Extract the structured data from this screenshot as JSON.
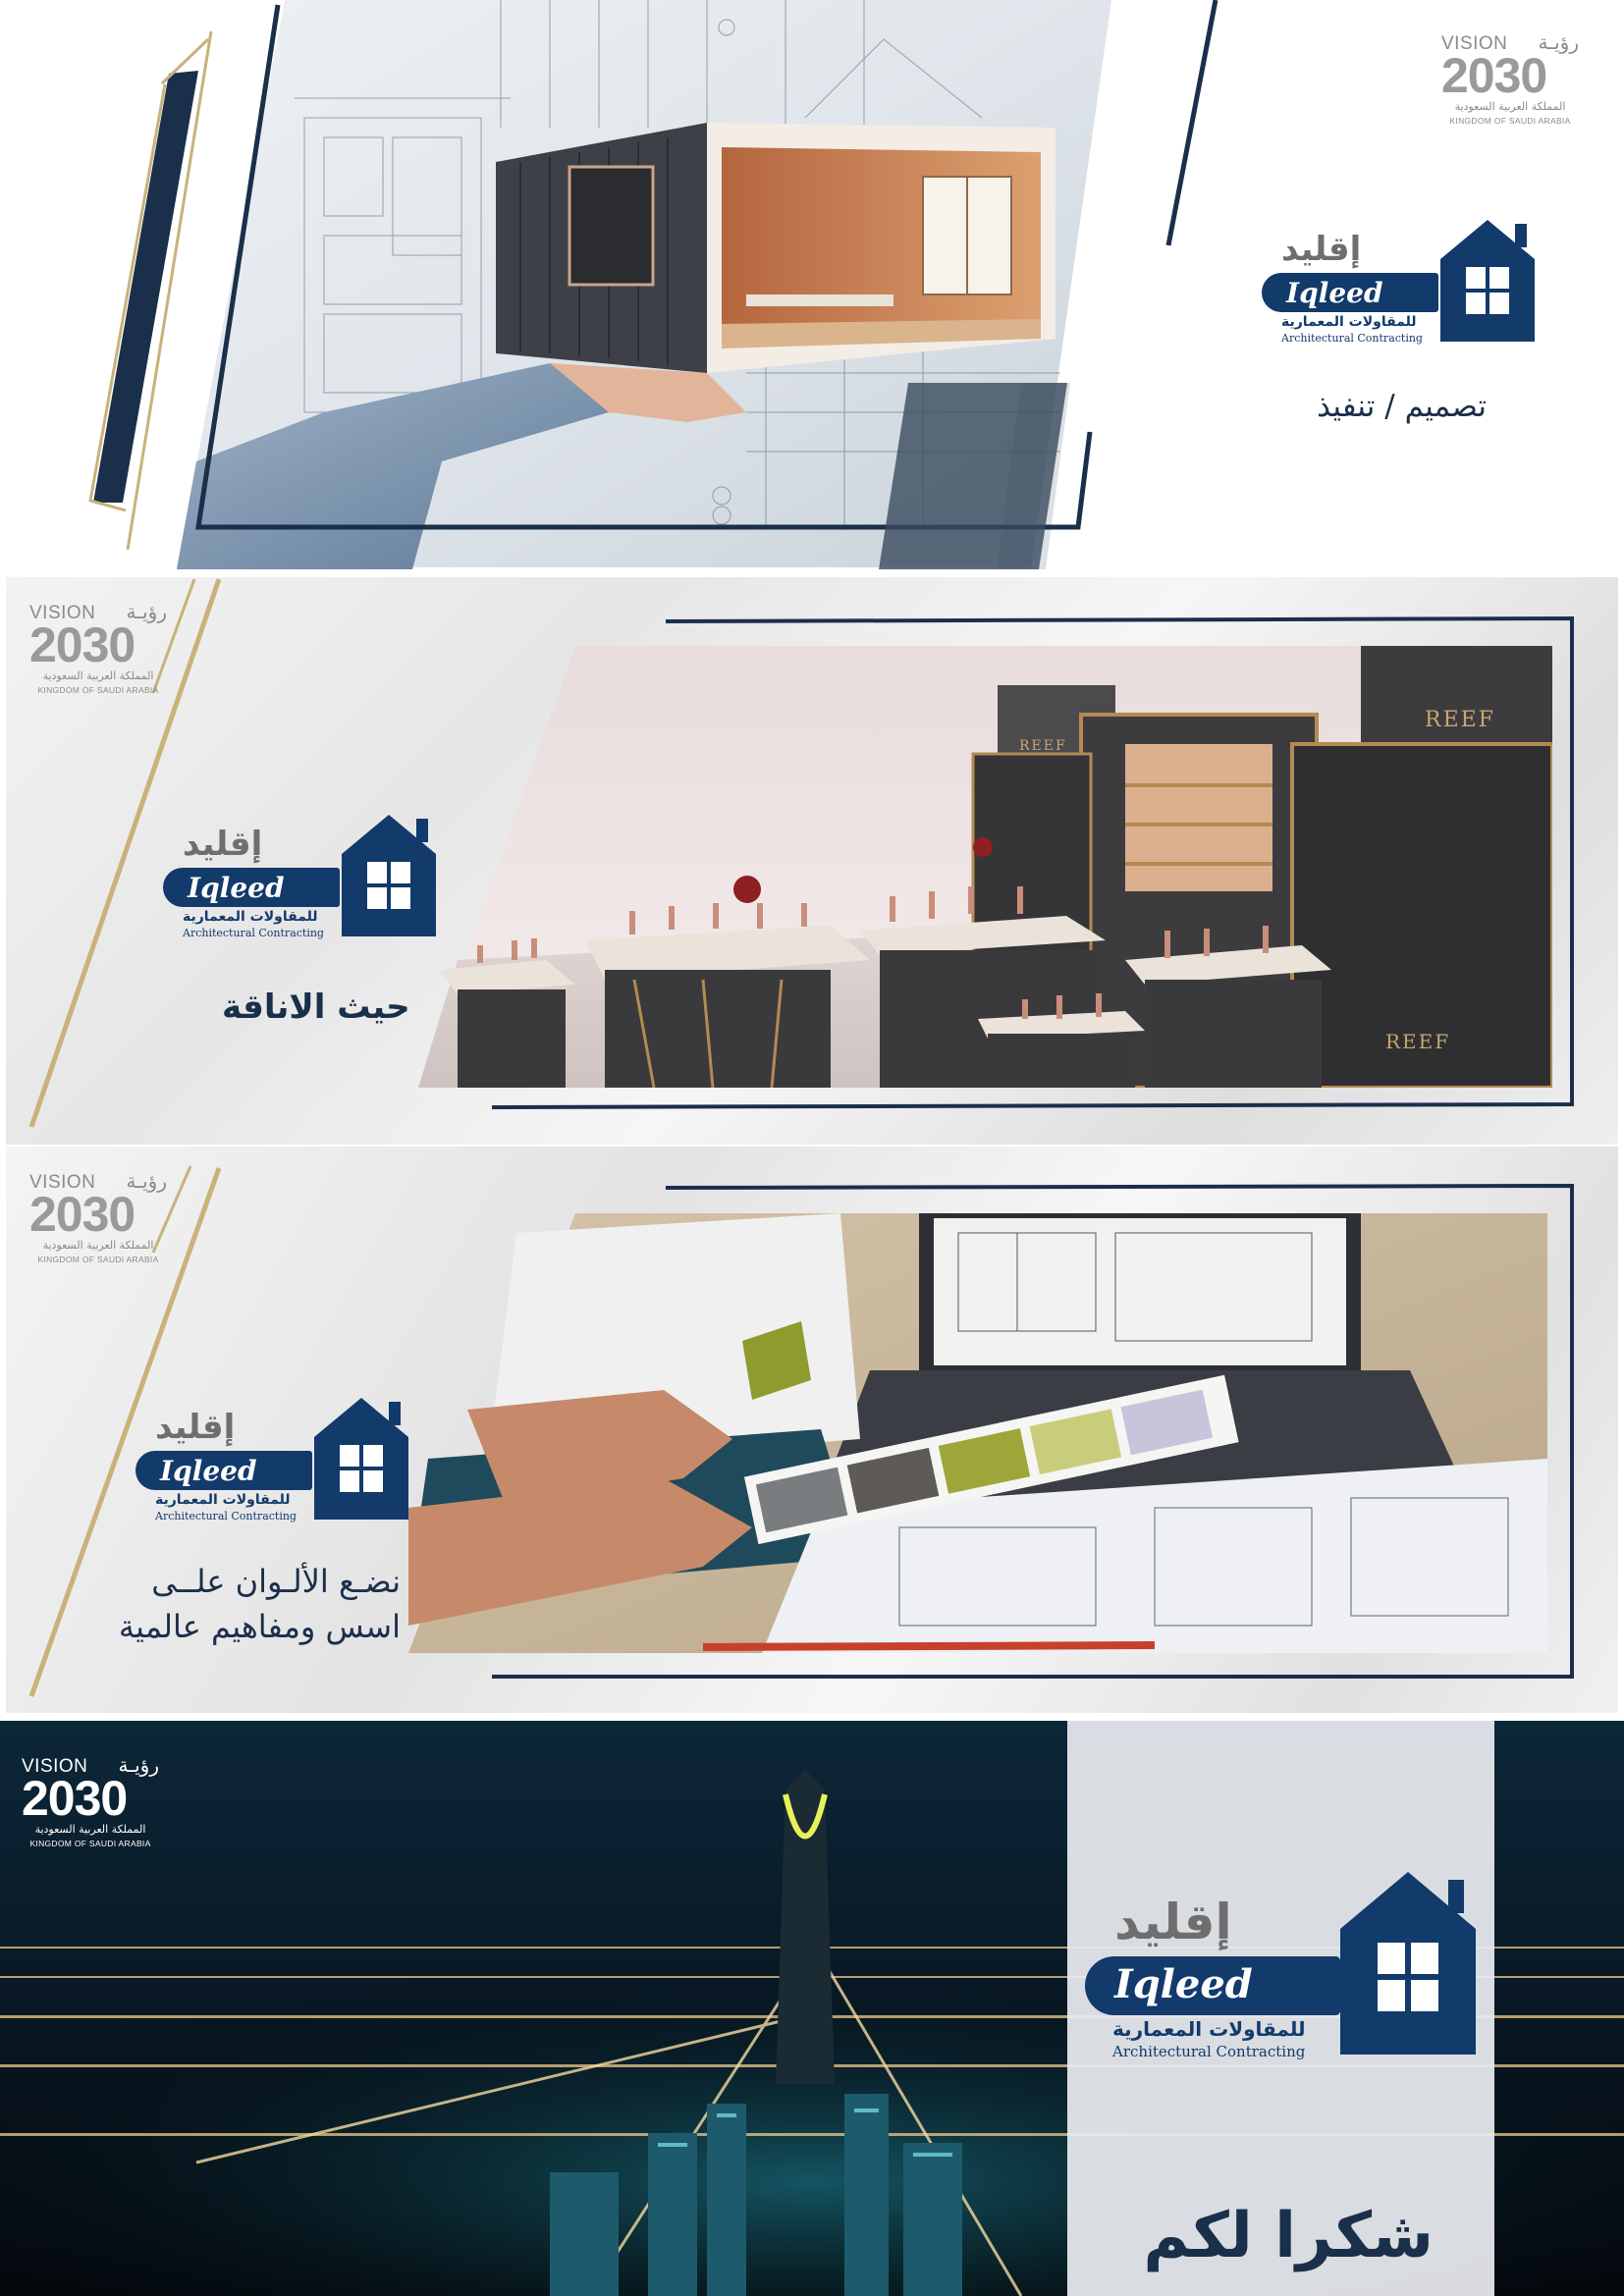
{
  "vision": {
    "word": "VISION",
    "arabic": "رؤيـة",
    "year": "2030",
    "country_ar": "المملكة العربية السعودية",
    "country_en": "KINGDOM OF SAUDI ARABIA"
  },
  "brand": {
    "name_ar": "إقليد",
    "name_en": "Iqleed",
    "subtitle_ar": "للمقاولات المعمارية",
    "subtitle_en": "Architectural Contracting"
  },
  "panels": [
    {
      "tagline": "تصميم / تنفيذ"
    },
    {
      "tagline": "حيث الاناقة",
      "booth_signs": [
        "REEF",
        "REEF",
        "REEF"
      ]
    },
    {
      "tagline_line1": "نضـع الألـوان علــى",
      "tagline_line2": "اسس ومفاهيم عالمية"
    },
    {
      "tagline": "شكرا لكم"
    }
  ],
  "colors": {
    "navy": "#1a2f4a",
    "brand_blue": "#123a6b",
    "gold": "#c9b27a",
    "grey_text": "#6e6e6e"
  },
  "icons": [
    "house-icon",
    "vision-emblem-icon"
  ]
}
